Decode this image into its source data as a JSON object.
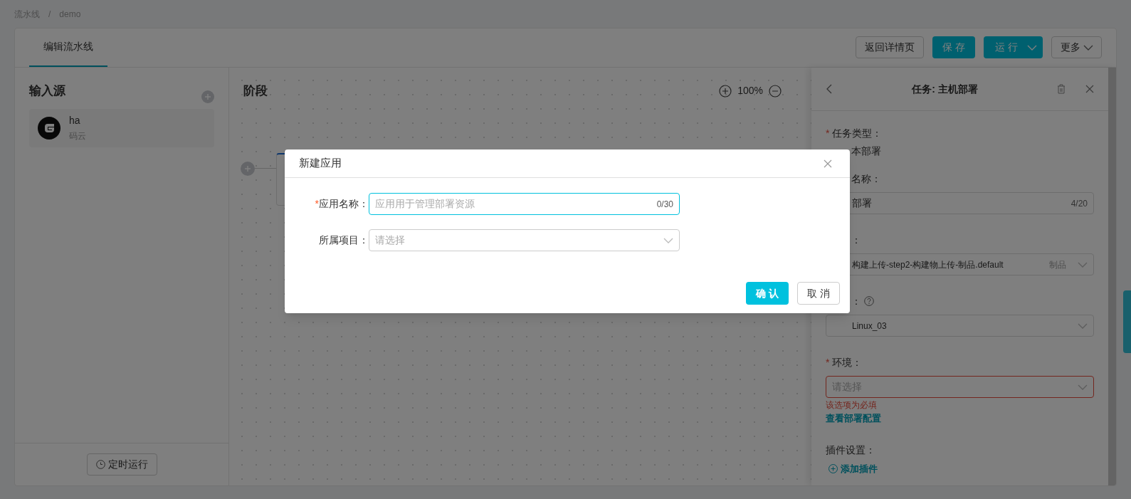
{
  "breadcrumb": {
    "items": [
      "流水线",
      "demo"
    ],
    "separator": "/"
  },
  "tabs": [
    {
      "label": "编辑流水线",
      "selected": true
    }
  ],
  "header_buttons": [
    {
      "label": "返回详情页",
      "kind": "outline"
    },
    {
      "label": "保 存",
      "kind": "primary"
    },
    {
      "label": "运 行",
      "kind": "split"
    },
    {
      "label": "更多",
      "kind": "dropdown"
    }
  ],
  "sources": {
    "title": "输入源",
    "items": [
      {
        "name": "ha",
        "provider": "码云"
      }
    ],
    "schedule_button": "定时运行"
  },
  "canvas": {
    "title": "阶段",
    "zoom": "100%"
  },
  "drawer": {
    "title": "任务: 主机部署",
    "fields": [
      {
        "kind": "text",
        "required_mark": "*",
        "label": "任务类型：",
        "covered_by_dialog": true,
        "value": "本部署"
      },
      {
        "kind": "input",
        "label": "名称：",
        "covered_by_dialog": true,
        "value": "部署",
        "counter": "4/20"
      },
      {
        "kind": "select",
        "label": "：",
        "covered_by_dialog": true,
        "value": "构建上传-step2-构建物上传-制品.default",
        "suffix": "制品"
      },
      {
        "kind": "select",
        "label": "：",
        "help": true,
        "covered_by_dialog": true,
        "value": "Linux_03"
      },
      {
        "kind": "select",
        "required_mark": "*",
        "label": "环境：",
        "placeholder": "请选择",
        "error": "该选项为必填",
        "link": "查看部署配置"
      }
    ],
    "plugins": {
      "label": "插件设置：",
      "add": "添加插件"
    }
  },
  "dialog": {
    "title": "新建应用",
    "fields": [
      {
        "kind": "input",
        "required_mark": "*",
        "label": "应用名称：",
        "focused": true,
        "placeholder": "应用用于管理部署资源",
        "counter": "0/30"
      },
      {
        "kind": "select",
        "label": "所属项目：",
        "focused": false,
        "placeholder": "请选择"
      }
    ],
    "buttons": [
      {
        "label": "确 认",
        "kind": "primary"
      },
      {
        "label": "取 消",
        "kind": "default"
      }
    ]
  }
}
